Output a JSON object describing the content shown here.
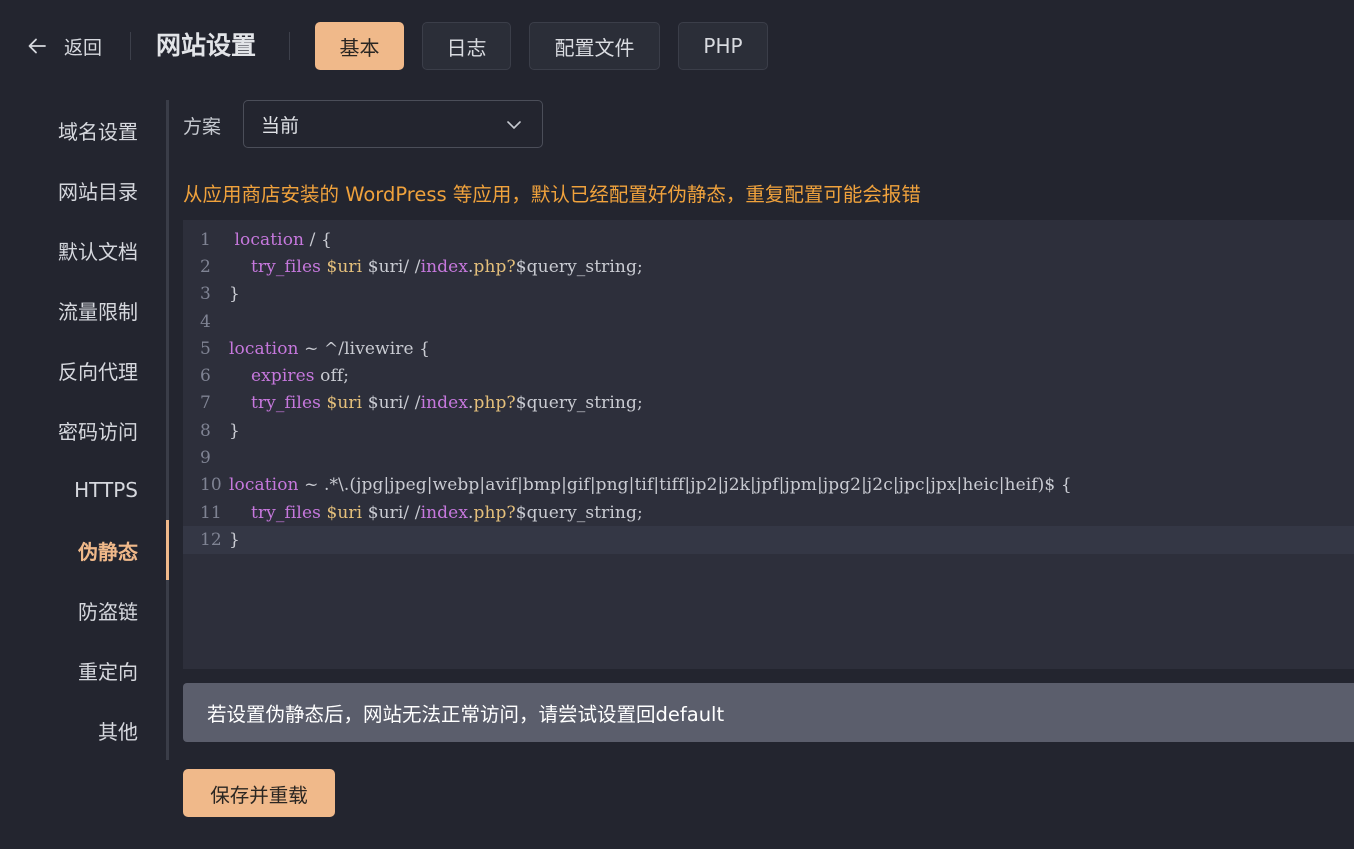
{
  "header": {
    "back_label": "返回",
    "title": "网站设置",
    "tabs": [
      {
        "label": "基本",
        "active": true
      },
      {
        "label": "日志",
        "active": false
      },
      {
        "label": "配置文件",
        "active": false
      },
      {
        "label": "PHP",
        "active": false
      }
    ]
  },
  "sidebar": {
    "items": [
      {
        "label": "域名设置"
      },
      {
        "label": "网站目录"
      },
      {
        "label": "默认文档"
      },
      {
        "label": "流量限制"
      },
      {
        "label": "反向代理"
      },
      {
        "label": "密码访问"
      },
      {
        "label": "HTTPS"
      },
      {
        "label": "伪静态",
        "active": true
      },
      {
        "label": "防盗链"
      },
      {
        "label": "重定向"
      },
      {
        "label": "其他"
      }
    ]
  },
  "main": {
    "scheme_label": "方案",
    "scheme_value": "当前",
    "warning": "从应用商店安装的 WordPress 等应用，默认已经配置好伪静态，重复配置可能会报错",
    "code_lines": [
      " location / {",
      "    try_files $uri $uri/ /index.php?$query_string;",
      "}",
      "",
      "location ~ ^/livewire {",
      "    expires off;",
      "    try_files $uri $uri/ /index.php?$query_string;",
      "}",
      "",
      "location ~ .*\\.(jpg|jpeg|webp|avif|bmp|gif|png|tif|tiff|jp2|j2k|jpf|jpm|jpg2|j2c|jpc|jpx|heic|heif)$ {",
      "    try_files $uri $uri/ /index.php?$query_string;",
      "}"
    ],
    "notice": "若设置伪静态后，网站无法正常访问，请尝试设置回default",
    "save_label": "保存并重载"
  },
  "colors": {
    "accent": "#f0b98a",
    "warning": "#f0a23c",
    "background": "#23252f",
    "editor_bg": "#2d2f3b"
  }
}
